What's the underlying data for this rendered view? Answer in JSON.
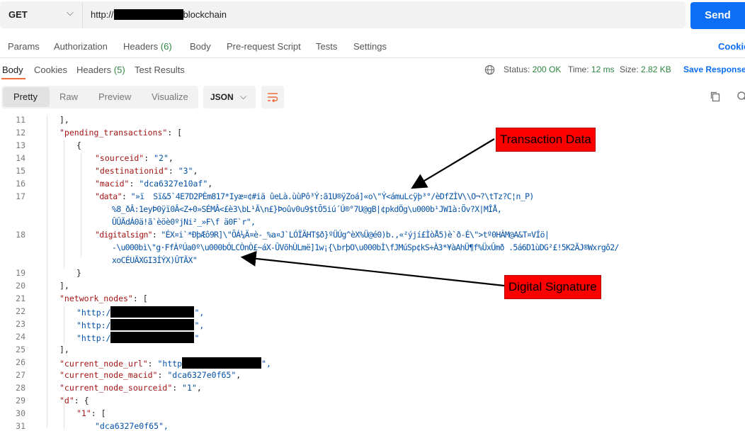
{
  "request": {
    "method": "GET",
    "url_prefix": "http://",
    "url_suffix": "blockchain",
    "send_label": "Send"
  },
  "request_tabs": {
    "params": "Params",
    "authorization": "Authorization",
    "headers": "Headers",
    "headers_count": "(6)",
    "body": "Body",
    "prerequest": "Pre-request Script",
    "tests": "Tests",
    "settings": "Settings",
    "cookies": "Cookie"
  },
  "response_tabs": {
    "body": "Body",
    "cookies": "Cookies",
    "headers": "Headers",
    "headers_count": "(5)",
    "test_results": "Test Results"
  },
  "response_meta": {
    "status_label": "Status:",
    "status_value": "200 OK",
    "time_label": "Time:",
    "time_value": "12 ms",
    "size_label": "Size:",
    "size_value": "2.82 KB",
    "save_label": "Save Response"
  },
  "format": {
    "pretty": "Pretty",
    "raw": "Raw",
    "preview": "Preview",
    "visualize": "Visualize",
    "lang": "JSON"
  },
  "code": {
    "line_numbers": [
      "11",
      "12",
      "13",
      "14",
      "15",
      "16",
      "17",
      "18",
      "19",
      "20",
      "21",
      "22",
      "23",
      "24",
      "25",
      "26",
      "27",
      "28",
      "29",
      "30",
      "31"
    ],
    "l11": "],",
    "l12_key": "\"pending_transactions\"",
    "l12_rest": ": [",
    "l13": "{",
    "l14_key": "\"sourceid\"",
    "l14_val": "\"2\"",
    "l15_key": "\"destinationid\"",
    "l15_val": "\"3\"",
    "l16_key": "\"macid\"",
    "l16_val": "\"dca6327e10af\"",
    "l17_key": "\"data\"",
    "l17_val_a": "\"»ï  Sï&5`4E7D2PÈm817*Iyæ¤¢#iä ûeLà.ùùPô³Ý:ã1U®ÿZoá]«o\\\"Ý<ámuLcÿþ³°/èDfZÌV\\\\O¬?\\tTz?C¦n_P)",
    "l17_val_b": "%8_ðÂ:1eyÞ0ÿï0Â<Z+0»SÉMÂ<£è3\\bL¹Ã\\n£}Þoûv0u9$tÕ5iú´Ú®°7U@gB|¢pkdÖg\\u000b¹JW1à:Õv?X|MÎÅ,",
    "l17_val_c": "ÛÛÃdÁ0ä!ã`èöè0ºjNi²_»F\\f ä0F`r\",",
    "l18_key": "\"digitalsign\"",
    "l18_val_a": "\"ÉX¤i`*ÐþÆô9R]\\\"ÕÁ¼Ä¤è-_%a¤J`LÓÏÄHT$ð}ºÜÚg^èX%Ü@é0)b.,«²ýjí£ÌòÅ5)è`ð-É\\\">tº0HÀM@A&T¤VÍö|",
    "l18_val_b": "-\\u000bì\\\"g·FfÀºÚa0º\\u000bÓLCÒnÒ£~áX-ÛVõhÙLmë]1w¡{\\brþO\\u000bÌ\\fJMúSp¢kS÷À3*¥àAhÜ¶f%ÜxÛmð .5á6D1ùDG²£!5K2ÃJ®Wxrgô2/",
    "l18_val_c": "xoCÉUÃXGI3ÍÝX)ÛTÃX\"",
    "l19": "}",
    "l20": "],",
    "l21_key": "\"network_nodes\"",
    "l21_rest": ": [",
    "l22": "\"http:/",
    "l22_end": "\",",
    "l23": "\"http:/",
    "l23_end": "\",",
    "l24": "\"http:/",
    "l24_end": "\"",
    "l25": "],",
    "l26_key": "\"current_node_url\"",
    "l26_val": "\"http",
    "l26_end": "\",",
    "l27_key": "\"current_node_macid\"",
    "l27_val": "\"dca6327e0f65\"",
    "l28_key": "\"current_node_sourceid\"",
    "l28_val": "\"1\"",
    "l29_key": "\"d\"",
    "l29_rest": ": {",
    "l30_key": "\"1\"",
    "l30_rest": ": [",
    "l31": "\"dca6327e0f65\","
  },
  "annotations": {
    "transaction_data": "Transaction Data",
    "digital_signature": "Digital Signature"
  },
  "colors": {
    "accent": "#0b6ef5",
    "status_ok": "#2e8540",
    "json_key": "#a31515",
    "json_string": "#0451a5",
    "callout": "#ff0000"
  }
}
